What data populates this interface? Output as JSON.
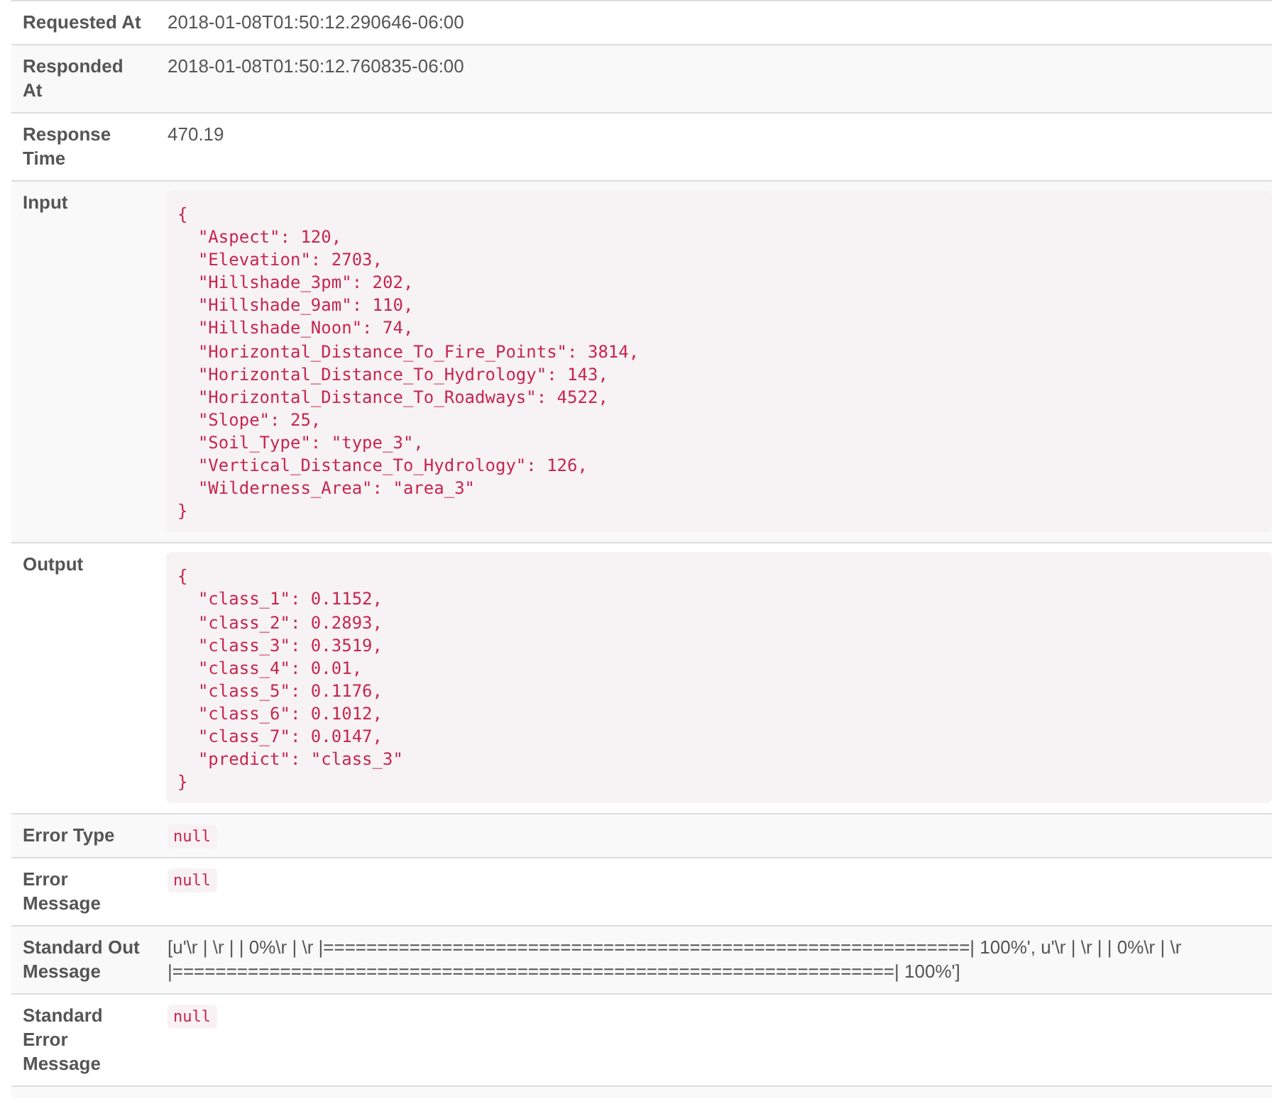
{
  "rows": [
    {
      "label": "Requested At",
      "kind": "text",
      "value": "2018-01-08T01:50:12.290646-06:00"
    },
    {
      "label": "Responded At",
      "kind": "text",
      "value": "2018-01-08T01:50:12.760835-06:00"
    },
    {
      "label": "Response Time",
      "kind": "text",
      "value": "470.19"
    },
    {
      "label": "Input",
      "kind": "code",
      "value": "{\n  \"Aspect\": 120,\n  \"Elevation\": 2703,\n  \"Hillshade_3pm\": 202,\n  \"Hillshade_9am\": 110,\n  \"Hillshade_Noon\": 74,\n  \"Horizontal_Distance_To_Fire_Points\": 3814,\n  \"Horizontal_Distance_To_Hydrology\": 143,\n  \"Horizontal_Distance_To_Roadways\": 4522,\n  \"Slope\": 25,\n  \"Soil_Type\": \"type_3\",\n  \"Vertical_Distance_To_Hydrology\": 126,\n  \"Wilderness_Area\": \"area_3\"\n}"
    },
    {
      "label": "Output",
      "kind": "code",
      "value": "{\n  \"class_1\": 0.1152,\n  \"class_2\": 0.2893,\n  \"class_3\": 0.3519,\n  \"class_4\": 0.01,\n  \"class_5\": 0.1176,\n  \"class_6\": 0.1012,\n  \"class_7\": 0.0147,\n  \"predict\": \"class_3\"\n}"
    },
    {
      "label": "Error Type",
      "kind": "inline_code",
      "value": "null"
    },
    {
      "label": "Error Message",
      "kind": "inline_code",
      "value": "null"
    },
    {
      "label": "Standard Out Message",
      "kind": "text",
      "value": "[u'\\r | \\r | | 0%\\r | \\r |============================================================| 100%', u'\\r | \\r | | 0%\\r | \\r |===================================================================| 100%']"
    },
    {
      "label": "Standard Error Message",
      "kind": "inline_code",
      "value": "null"
    }
  ]
}
